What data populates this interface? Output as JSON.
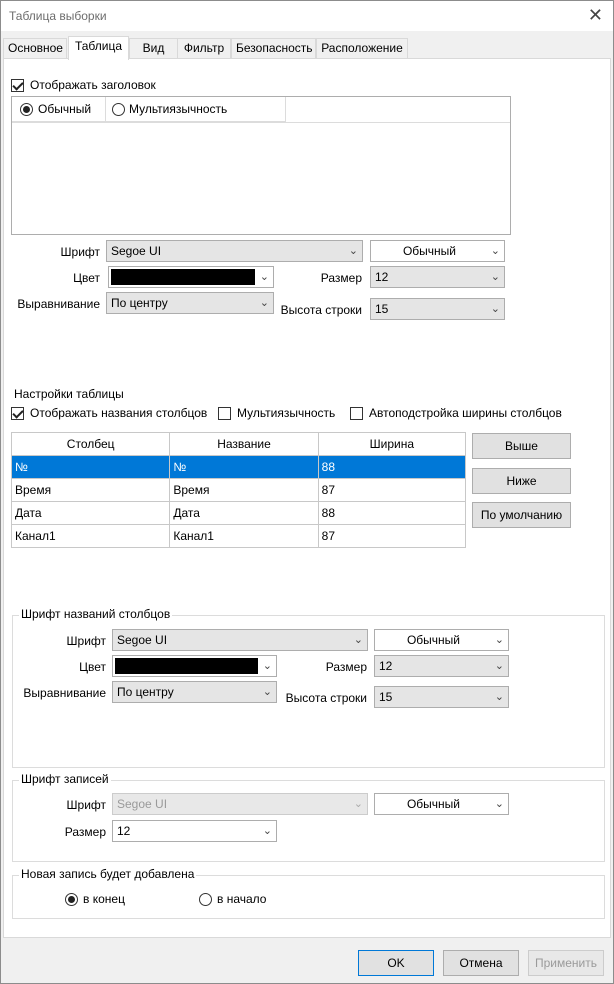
{
  "window": {
    "title": "Таблица выборки",
    "close_glyph": "✕"
  },
  "tabs": [
    "Основное",
    "Таблица",
    "Вид",
    "Фильтр",
    "Безопасность",
    "Расположение"
  ],
  "active_tab": "Таблица",
  "header": {
    "show_label": "Отображать заголовок",
    "show_checked": true,
    "mode_normal": "Обычный",
    "mode_multi": "Мультиязычность",
    "font_label": "Шрифт",
    "font_value": "Segoe UI",
    "style_value": "Обычный",
    "color_label": "Цвет",
    "color_value": "#000000",
    "size_label": "Размер",
    "size_value": "12",
    "align_label": "Выравнивание",
    "align_value": "По центру",
    "row_height_label": "Высота строки",
    "row_height_value": "15"
  },
  "table_settings": {
    "title": "Настройки таблицы",
    "show_column_names": "Отображать названия столбцов",
    "multilang": "Мультиязычность",
    "autofit": "Автоподстройка ширины столбцов",
    "show_column_names_checked": true,
    "multilang_checked": false,
    "autofit_checked": false,
    "columns": [
      "Столбец",
      "Название",
      "Ширина"
    ],
    "rows": [
      [
        "№",
        "№",
        "88"
      ],
      [
        "Время",
        "Время",
        "87"
      ],
      [
        "Дата",
        "Дата",
        "88"
      ],
      [
        "Канал1",
        "Канал1",
        "87"
      ]
    ],
    "selected_row": 0,
    "up_button": "Выше",
    "down_button": "Ниже",
    "default_button": "По умолчанию"
  },
  "column_font": {
    "title": "Шрифт названий столбцов",
    "font_label": "Шрифт",
    "font_value": "Segoe UI",
    "style_value": "Обычный",
    "color_label": "Цвет",
    "color_value": "#000000",
    "size_label": "Размер",
    "size_value": "12",
    "align_label": "Выравнивание",
    "align_value": "По центру",
    "row_height_label": "Высота строки",
    "row_height_value": "15"
  },
  "record_font": {
    "title": "Шрифт записей",
    "font_label": "Шрифт",
    "font_value": "Segoe UI",
    "style_value": "Обычный",
    "size_label": "Размер",
    "size_value": "12"
  },
  "new_record": {
    "title": "Новая запись будет добавлена",
    "to_end": "в конец",
    "to_start": "в начало",
    "selected": "to_end"
  },
  "buttons": {
    "ok": "OK",
    "cancel": "Отмена",
    "apply": "Применить"
  },
  "icons": {
    "chevron": "chevron-down-icon",
    "close": "close-icon"
  }
}
